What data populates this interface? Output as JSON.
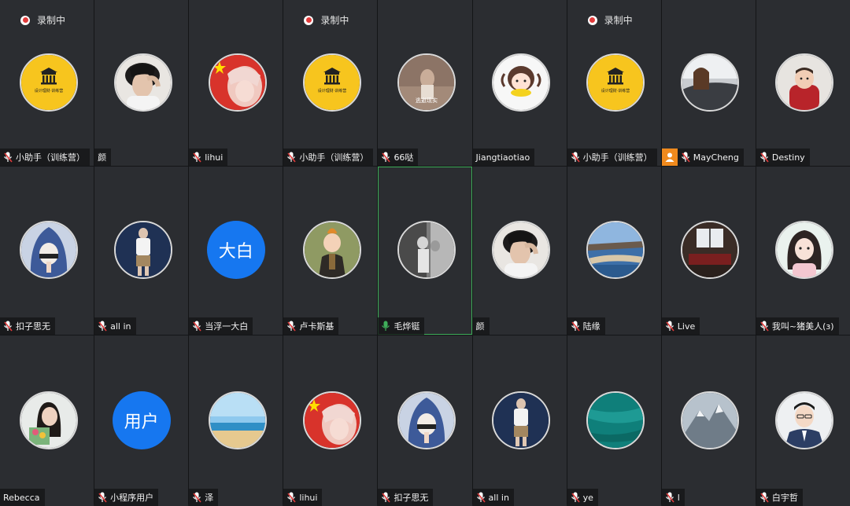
{
  "recording_label": "录制中",
  "colors": {
    "tile_bg": "#2b2d31",
    "mic_red": "#e23b3b",
    "mic_green": "#3fae5a",
    "active_border": "#3fae5a",
    "text_avatar_bg": "#1677f0",
    "user_badge_bg": "#f08a1d"
  },
  "tiles": [
    {
      "name": "小助手（训练营）",
      "mic": "muted",
      "recording": true,
      "avatar": "logo-camp",
      "logo_text": "设计理财·训练营"
    },
    {
      "name": "颜",
      "mic": "none",
      "recording": false,
      "avatar": "photo-man-hand"
    },
    {
      "name": "lihui",
      "mic": "muted",
      "recording": false,
      "avatar": "photo-anime-flag"
    },
    {
      "name": "小助手（训练营）",
      "mic": "muted",
      "recording": true,
      "avatar": "logo-camp",
      "logo_text": "设计理财·训练营"
    },
    {
      "name": "66哒",
      "mic": "muted",
      "recording": false,
      "avatar": "photo-escape",
      "avatar_text": "逃避现实"
    },
    {
      "name": "Jiangtiaotiao",
      "mic": "none",
      "recording": false,
      "avatar": "cartoon-girl-corn"
    },
    {
      "name": "小助手（训练营）",
      "mic": "muted",
      "recording": true,
      "avatar": "logo-camp",
      "logo_text": "设计理财·训练营"
    },
    {
      "name": "MayCheng",
      "mic": "muted",
      "recording": false,
      "avatar": "photo-car",
      "user_badge": true
    },
    {
      "name": "Destiny",
      "mic": "muted",
      "recording": false,
      "avatar": "photo-baby"
    },
    {
      "name": "扣子思无",
      "mic": "muted",
      "recording": false,
      "avatar": "cartoon-hood"
    },
    {
      "name": "all in",
      "mic": "muted",
      "recording": false,
      "avatar": "photo-standing"
    },
    {
      "name": "当浮一大白",
      "mic": "muted",
      "recording": false,
      "avatar": "text",
      "avatar_text": "大白"
    },
    {
      "name": "卢卡斯基",
      "mic": "muted",
      "recording": false,
      "avatar": "cartoon-tintin"
    },
    {
      "name": "毛烨铤",
      "mic": "active",
      "recording": false,
      "avatar": "photo-bw",
      "active": true
    },
    {
      "name": "颜",
      "mic": "none",
      "recording": false,
      "avatar": "photo-man-hand"
    },
    {
      "name": "陆缘",
      "mic": "muted",
      "recording": false,
      "avatar": "photo-river"
    },
    {
      "name": "Live",
      "mic": "muted",
      "recording": false,
      "avatar": "photo-room"
    },
    {
      "name": "我叫~猪美人(з)",
      "mic": "muted",
      "recording": false,
      "avatar": "cartoon-girl-hair"
    },
    {
      "name": "Rebecca",
      "mic": "none",
      "recording": false,
      "avatar": "photo-woman-flowers"
    },
    {
      "name": "小程序用户",
      "mic": "muted",
      "recording": false,
      "avatar": "text",
      "avatar_text": "用户"
    },
    {
      "name": "泽",
      "mic": "muted",
      "recording": false,
      "avatar": "photo-beach"
    },
    {
      "name": "lihui",
      "mic": "muted",
      "recording": false,
      "avatar": "photo-anime-flag"
    },
    {
      "name": "扣子思无",
      "mic": "muted",
      "recording": false,
      "avatar": "cartoon-hood"
    },
    {
      "name": "all in",
      "mic": "muted",
      "recording": false,
      "avatar": "photo-standing"
    },
    {
      "name": "ye",
      "mic": "muted",
      "recording": false,
      "avatar": "photo-sea"
    },
    {
      "name": "l",
      "mic": "muted",
      "recording": false,
      "avatar": "photo-mountain"
    },
    {
      "name": "白宇哲",
      "mic": "muted",
      "recording": false,
      "avatar": "cartoon-man-suit"
    }
  ]
}
